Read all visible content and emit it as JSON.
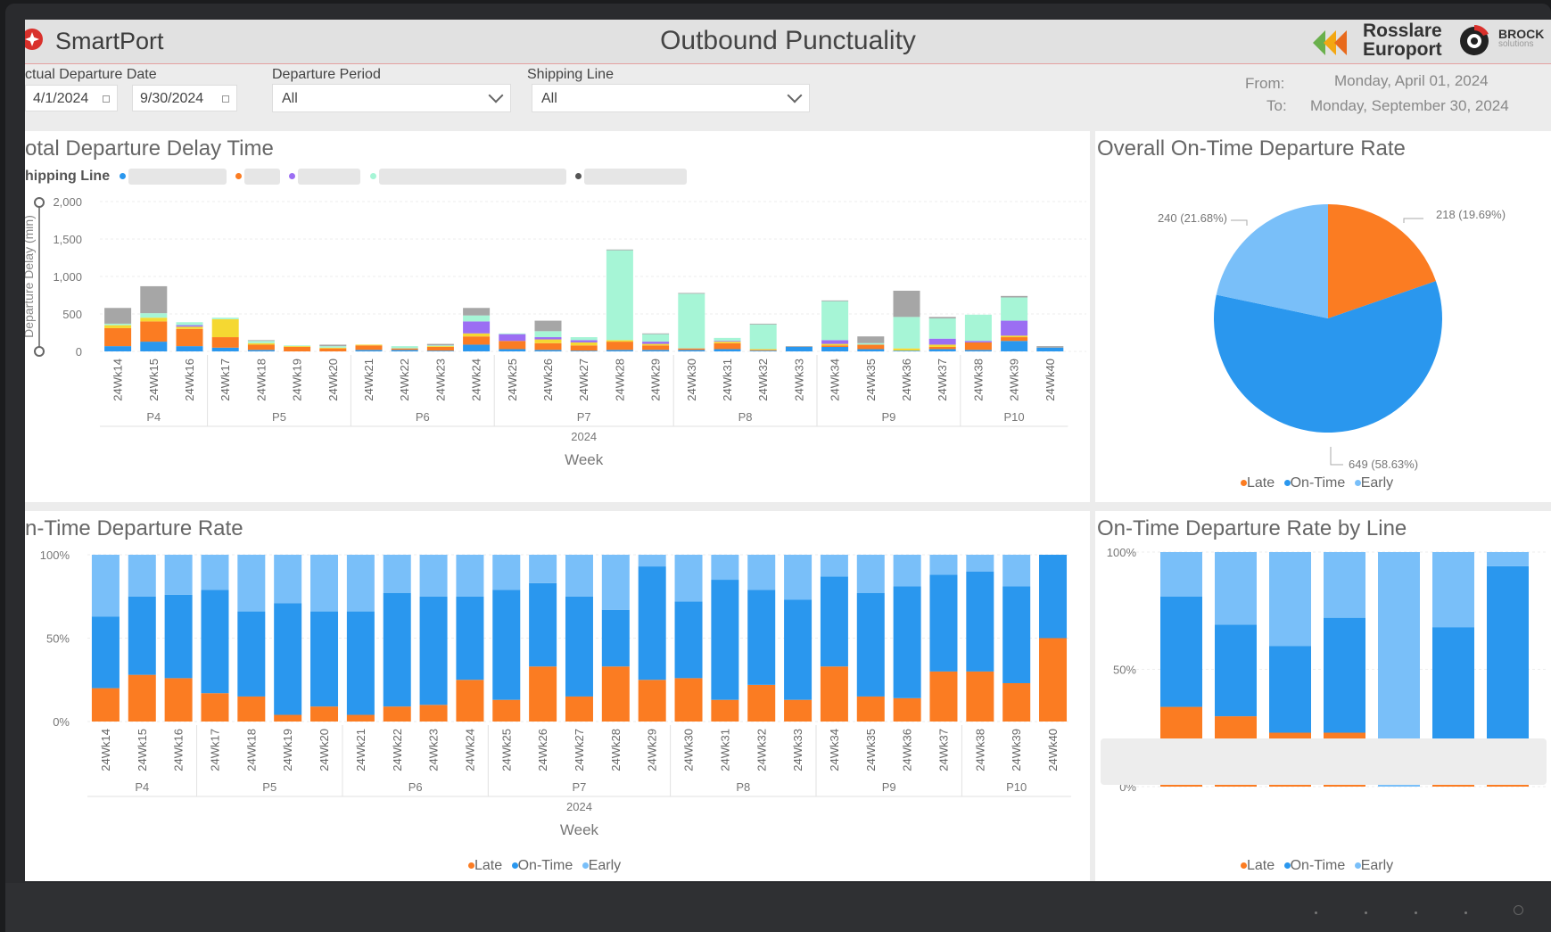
{
  "header": {
    "app_name": "SmartPort",
    "title": "Outbound Punctuality",
    "partner1_line1": "Rosslare",
    "partner1_line2": "Europort",
    "partner2_name": "BROCK",
    "partner2_sub": "solutions"
  },
  "filters": {
    "departure_date_label": "ctual Departure Date",
    "date_from": "4/1/2024",
    "date_to": "9/30/2024",
    "period_label": "Departure Period",
    "period_value": "All",
    "shipping_label": "Shipping Line",
    "shipping_value": "All",
    "from_label": "From:",
    "from_value": "Monday, April 01, 2024",
    "to_label": "To:",
    "to_value": "Monday, September 30, 2024"
  },
  "colors": {
    "late": "#fb7c22",
    "ontime": "#2a97ee",
    "early": "#79bff9",
    "gray": "#a6a6a6",
    "yellow": "#f5d832",
    "purple": "#9b6ef3",
    "mint": "#a6f5d6"
  },
  "panels": {
    "delay": {
      "title": "otal Departure Delay Time",
      "legend_label": "hipping Line",
      "ylabel": "Departure Delay (min)",
      "year": "2024",
      "xlabel": "Week"
    },
    "overall": {
      "title": "Overall On-Time Departure Rate",
      "legend": [
        "Late",
        "On-Time",
        "Early"
      ]
    },
    "weekly": {
      "title": "n-Time Departure Rate",
      "year": "2024",
      "xlabel": "Week",
      "legend": [
        "Late",
        "On-Time",
        "Early"
      ]
    },
    "byline": {
      "title": "On-Time Departure Rate by Line",
      "legend": [
        "Late",
        "On-Time",
        "Early"
      ]
    }
  },
  "chart_data": [
    {
      "type": "bar",
      "title": "otal Departure Delay Time",
      "ylabel": "Departure Delay (min)",
      "xlabel": "Week",
      "ylim": [
        0,
        2000
      ],
      "yticks": [
        "2,000",
        "1,500",
        "1,000",
        "500",
        "0"
      ],
      "ytick_values": [
        2000,
        1500,
        1000,
        500,
        0
      ],
      "categories": [
        "24Wk14",
        "24Wk15",
        "24Wk16",
        "24Wk17",
        "24Wk18",
        "24Wk19",
        "24Wk20",
        "24Wk21",
        "24Wk22",
        "24Wk23",
        "24Wk24",
        "24Wk25",
        "24Wk26",
        "24Wk27",
        "24Wk28",
        "24Wk29",
        "24Wk30",
        "24Wk31",
        "24Wk32",
        "24Wk33",
        "24Wk34",
        "24Wk35",
        "24Wk36",
        "24Wk37",
        "24Wk38",
        "24Wk39",
        "24Wk40"
      ],
      "periods": [
        {
          "label": "P4",
          "weeks": 3
        },
        {
          "label": "P5",
          "weeks": 4
        },
        {
          "label": "P6",
          "weeks": 4
        },
        {
          "label": "P7",
          "weeks": 5
        },
        {
          "label": "P8",
          "weeks": 4
        },
        {
          "label": "P9",
          "weeks": 4
        },
        {
          "label": "P10",
          "weeks": 3
        }
      ],
      "year": "2024",
      "stacked": true,
      "series": [
        {
          "color": "#2a97ee",
          "values": [
            70,
            130,
            70,
            50,
            20,
            0,
            0,
            20,
            20,
            10,
            90,
            30,
            20,
            10,
            20,
            20,
            20,
            30,
            10,
            60,
            60,
            30,
            10,
            30,
            20,
            140,
            50
          ]
        },
        {
          "color": "#fb7c22",
          "values": [
            240,
            270,
            230,
            140,
            70,
            60,
            40,
            60,
            20,
            50,
            110,
            110,
            90,
            70,
            110,
            60,
            20,
            80,
            10,
            0,
            20,
            60,
            0,
            30,
            100,
            50,
            0
          ]
        },
        {
          "color": "#f5d832",
          "values": [
            40,
            50,
            30,
            240,
            20,
            10,
            10,
            10,
            0,
            10,
            40,
            0,
            50,
            40,
            20,
            20,
            0,
            20,
            10,
            0,
            20,
            0,
            30,
            30,
            0,
            20,
            0
          ]
        },
        {
          "color": "#9b6ef3",
          "values": [
            0,
            0,
            20,
            0,
            0,
            0,
            0,
            0,
            0,
            0,
            160,
            90,
            30,
            30,
            0,
            30,
            0,
            10,
            0,
            0,
            50,
            0,
            0,
            80,
            20,
            200,
            0
          ]
        },
        {
          "color": "#a6f5d6",
          "values": [
            20,
            60,
            40,
            20,
            30,
            10,
            20,
            0,
            30,
            10,
            80,
            10,
            80,
            40,
            1200,
            100,
            730,
            40,
            330,
            0,
            520,
            20,
            420,
            270,
            350,
            310,
            0
          ]
        },
        {
          "color": "#a6a6a6",
          "values": [
            210,
            360,
            0,
            0,
            10,
            0,
            20,
            0,
            0,
            20,
            100,
            0,
            140,
            0,
            10,
            10,
            10,
            0,
            10,
            10,
            10,
            90,
            350,
            20,
            0,
            20,
            20
          ]
        }
      ]
    },
    {
      "type": "pie",
      "title": "Overall On-Time Departure Rate",
      "slices": [
        {
          "label": "Late",
          "value": 218,
          "text": "218 (19.69%)",
          "color": "#fb7c22"
        },
        {
          "label": "On-Time",
          "value": 649,
          "text": "649 (58.63%)",
          "color": "#2a97ee"
        },
        {
          "label": "Early",
          "value": 240,
          "text": "240 (21.68%)",
          "color": "#79bff9"
        }
      ]
    },
    {
      "type": "bar",
      "title": "n-Time Departure Rate",
      "xlabel": "Week",
      "ylim": [
        0,
        100
      ],
      "yticks": [
        "100%",
        "50%",
        "0%"
      ],
      "ytick_values": [
        100,
        50,
        0
      ],
      "stacked": true,
      "categories": [
        "24Wk14",
        "24Wk15",
        "24Wk16",
        "24Wk17",
        "24Wk18",
        "24Wk19",
        "24Wk20",
        "24Wk21",
        "24Wk22",
        "24Wk23",
        "24Wk24",
        "24Wk25",
        "24Wk26",
        "24Wk27",
        "24Wk28",
        "24Wk29",
        "24Wk30",
        "24Wk31",
        "24Wk32",
        "24Wk33",
        "24Wk34",
        "24Wk35",
        "24Wk36",
        "24Wk37",
        "24Wk38",
        "24Wk39",
        "24Wk40"
      ],
      "periods": [
        {
          "label": "P4",
          "weeks": 3
        },
        {
          "label": "P5",
          "weeks": 4
        },
        {
          "label": "P6",
          "weeks": 4
        },
        {
          "label": "P7",
          "weeks": 5
        },
        {
          "label": "P8",
          "weeks": 4
        },
        {
          "label": "P9",
          "weeks": 4
        },
        {
          "label": "P10",
          "weeks": 3
        }
      ],
      "year": "2024",
      "series": [
        {
          "name": "Late",
          "color": "#fb7c22",
          "values": [
            20,
            28,
            26,
            17,
            15,
            4,
            9,
            4,
            9,
            10,
            25,
            13,
            33,
            15,
            33,
            25,
            26,
            13,
            22,
            13,
            33,
            15,
            14,
            30,
            30,
            23,
            50
          ]
        },
        {
          "name": "On-Time",
          "color": "#2a97ee",
          "values": [
            43,
            47,
            50,
            62,
            51,
            67,
            57,
            62,
            68,
            65,
            50,
            66,
            50,
            60,
            34,
            68,
            46,
            72,
            57,
            60,
            54,
            62,
            67,
            58,
            60,
            58,
            50
          ]
        },
        {
          "name": "Early",
          "color": "#79bff9",
          "values": [
            37,
            25,
            24,
            21,
            34,
            29,
            34,
            34,
            23,
            25,
            25,
            21,
            17,
            25,
            33,
            7,
            28,
            15,
            21,
            27,
            13,
            23,
            19,
            12,
            10,
            19,
            0
          ]
        }
      ]
    },
    {
      "type": "bar",
      "title": "On-Time Departure Rate by Line",
      "ylim": [
        0,
        100
      ],
      "yticks": [
        "100%",
        "50%",
        "0%"
      ],
      "ytick_values": [
        100,
        50,
        0
      ],
      "stacked": true,
      "categories": [
        "",
        "",
        "",
        "",
        "",
        "",
        ""
      ],
      "series": [
        {
          "name": "Late",
          "color": "#fb7c22",
          "values": [
            34,
            30,
            23,
            23,
            0,
            10,
            12
          ]
        },
        {
          "name": "On-Time",
          "color": "#2a97ee",
          "values": [
            47,
            39,
            37,
            49,
            0,
            58,
            82
          ]
        },
        {
          "name": "Early",
          "color": "#79bff9",
          "values": [
            19,
            31,
            40,
            28,
            100,
            32,
            6
          ]
        }
      ]
    }
  ]
}
